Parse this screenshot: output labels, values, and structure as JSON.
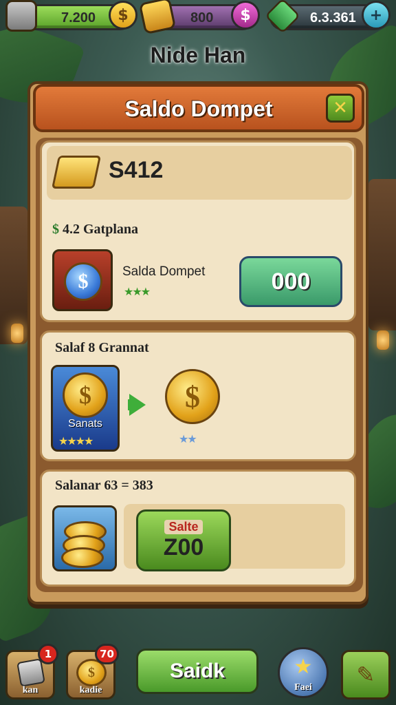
{
  "resources": [
    {
      "value": "7.200",
      "icon": "card-icon",
      "color": "#7cc343"
    },
    {
      "value": "800",
      "icon": "gold-bar-icon",
      "color": "#7a4e86"
    },
    {
      "value": "6.3.361",
      "icon": "gem-icon",
      "color": "#3b4a52"
    }
  ],
  "screen_title": "Nide Han",
  "panel": {
    "title": "Saldo Dompet",
    "balance": "S412",
    "section1": {
      "label": "4.2 Gatplana",
      "prefix_symbol": "$",
      "item_name": "Salda Dompet",
      "button_value": "000"
    },
    "section2": {
      "label": "Salaf 8 Grannat",
      "item_tag": "Sanats"
    },
    "section3": {
      "label": "Salanar 63 = 383",
      "button_label": "Salte",
      "button_value": "Z00"
    }
  },
  "bottom_nav": [
    {
      "label": "kan",
      "badge": "1"
    },
    {
      "label": "kadie",
      "badge": "70"
    },
    {
      "label": "Saidk"
    },
    {
      "label": "Faei"
    },
    {
      "label": ""
    }
  ],
  "colors": {
    "accent_green": "#5fbf5a",
    "header_orange": "#d8692e",
    "panel_cream": "#f2e4c6",
    "coin_gold": "#e2a21a",
    "badge_red": "#d8261e"
  }
}
